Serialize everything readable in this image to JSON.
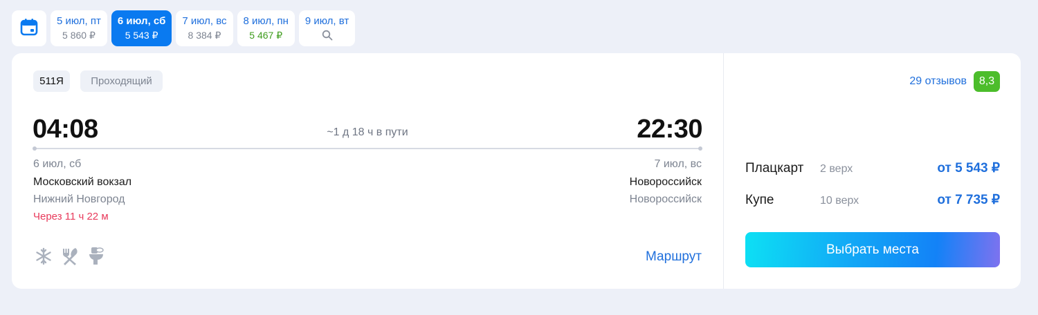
{
  "date_strip": {
    "calendar_icon": "calendar-icon",
    "tabs": [
      {
        "label": "5 июл, пт",
        "price": "5 860 ₽",
        "active": false,
        "cheap": false
      },
      {
        "label": "6 июл, сб",
        "price": "5 543 ₽",
        "active": true,
        "cheap": false
      },
      {
        "label": "7 июл, вс",
        "price": "8 384 ₽",
        "active": false,
        "cheap": false
      },
      {
        "label": "8 июл, пн",
        "price": "5 467 ₽",
        "active": false,
        "cheap": true
      },
      {
        "label": "9 июл, вт",
        "icon": "search-icon",
        "active": false
      }
    ]
  },
  "train": {
    "number": "511Я",
    "type": "Проходящий",
    "departure": {
      "time": "04:08",
      "date": "6 июл, сб",
      "station": "Московский вокзал",
      "city": "Нижний Новгород",
      "countdown": "Через 11 ч 22 м"
    },
    "arrival": {
      "time": "22:30",
      "date": "7 июл, вс",
      "station": "Новороссийск",
      "city": "Новороссийск"
    },
    "duration": "~1 д 18 ч в пути",
    "amenities": [
      "snowflake-icon",
      "fork-knife-icon",
      "toilet-icon"
    ],
    "route_link": "Маршрут"
  },
  "offer": {
    "reviews": "29 отзывов",
    "rating": "8,3",
    "fares": [
      {
        "class": "Плацкарт",
        "seats": "2 верх",
        "price": "от 5 543 ₽"
      },
      {
        "class": "Купе",
        "seats": "10 верх",
        "price": "от 7 735 ₽"
      }
    ],
    "select_button": "Выбрать места"
  },
  "colors": {
    "accent": "#1f6fdc",
    "active_tab": "#0a7af0",
    "rating_green": "#4cbd2b",
    "countdown_red": "#e83a5b",
    "cheap_green": "#3e9c1c"
  }
}
